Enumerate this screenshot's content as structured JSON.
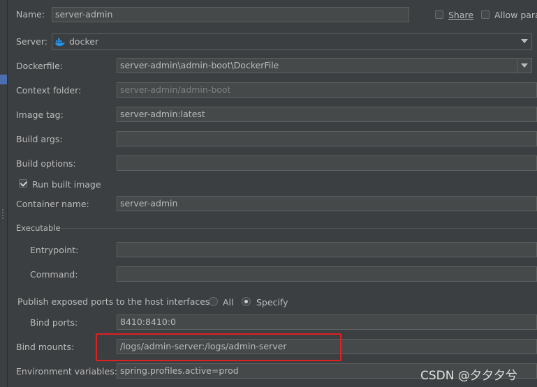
{
  "form": {
    "name_label": "Name:",
    "name_value": "server-admin",
    "share_label": "Share",
    "allow_parallel_label": "Allow para",
    "server_label": "Server:",
    "server_value": "docker",
    "dockerfile_label": "Dockerfile:",
    "dockerfile_value": "server-admin\\admin-boot\\DockerFile",
    "context_label": "Context folder:",
    "context_value": "server-admin/admin-boot",
    "image_tag_label": "Image tag:",
    "image_tag_value": "server-admin:latest",
    "build_args_label": "Build args:",
    "build_args_value": "",
    "build_options_label": "Build options:",
    "build_options_value": "",
    "run_built_label": "Run built image",
    "container_name_label": "Container name:",
    "container_name_value": "server-admin",
    "executable_label": "Executable",
    "entrypoint_label": "Entrypoint:",
    "entrypoint_value": "",
    "command_label": "Command:",
    "command_value": "",
    "publish_label": "Publish exposed ports to the host interfaces:",
    "all_label": "All",
    "specify_label": "Specify",
    "bind_ports_label": "Bind ports:",
    "bind_ports_value": "8410:8410:0",
    "bind_mounts_label": "Bind mounts:",
    "bind_mounts_value": "/logs/admin-server:/logs/admin-server",
    "env_label": "Environment variables:",
    "env_value": "spring.profiles.active=prod"
  },
  "watermark": "CSDN @夕夕夕兮",
  "colors": {
    "background": "#3c3f41",
    "field": "#45494a",
    "highlight": "#e02020",
    "docker_blue": "#2496ed"
  }
}
